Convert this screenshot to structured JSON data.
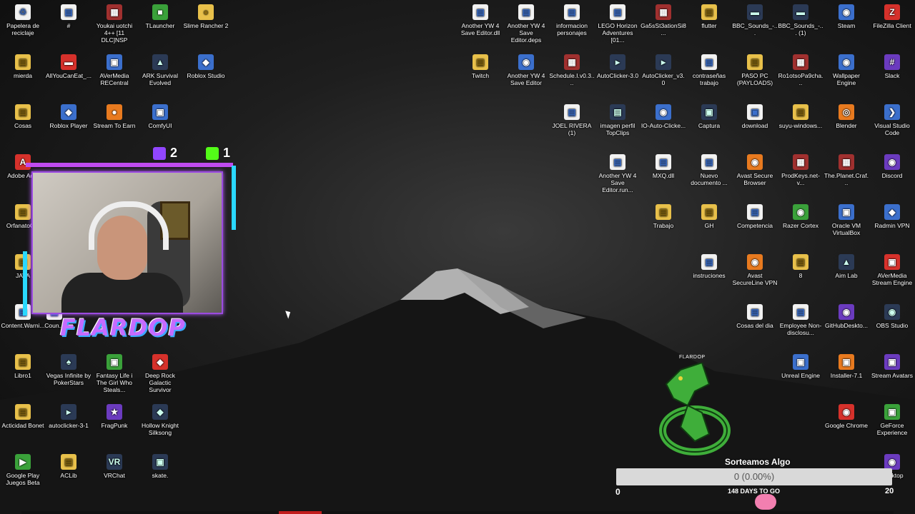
{
  "desktop_icons_left": [
    {
      "label": "Papelera de reciclaje",
      "glyph": "♲",
      "kind": "g-file",
      "icon": "recycle-bin-icon"
    },
    {
      "label": "#",
      "glyph": "▤",
      "kind": "g-file",
      "icon": "file-icon"
    },
    {
      "label": "Youkai uotchi 4++ [11 DLC]NSP",
      "glyph": "▦",
      "kind": "g-rar",
      "icon": "winrar-icon"
    },
    {
      "label": "TLauncher",
      "glyph": "■",
      "kind": "g-green",
      "icon": "tlauncher-icon"
    },
    {
      "label": "Slime Rancher 2",
      "glyph": "●",
      "kind": "g-folder",
      "icon": "slime-rancher-icon"
    },
    {
      "label": "mierda",
      "glyph": "▤",
      "kind": "g-folder",
      "icon": "folder-icon"
    },
    {
      "label": "AllYouCanEat_...",
      "glyph": "▬",
      "kind": "g-red",
      "icon": "file-icon"
    },
    {
      "label": "AVerMedia RECentral",
      "glyph": "▣",
      "kind": "g-app",
      "icon": "avermedia-icon"
    },
    {
      "label": "ARK Survival Evolved",
      "glyph": "▲",
      "kind": "g-dark",
      "icon": "ark-icon"
    },
    {
      "label": "Roblox Studio",
      "glyph": "◆",
      "kind": "g-app",
      "icon": "roblox-studio-icon"
    },
    {
      "label": "Cosas",
      "glyph": "▤",
      "kind": "g-folder",
      "icon": "folder-icon"
    },
    {
      "label": "Roblox Player",
      "glyph": "◆",
      "kind": "g-app",
      "icon": "roblox-icon"
    },
    {
      "label": "Stream To Earn",
      "glyph": "●",
      "kind": "g-orange",
      "icon": "stream-to-earn-icon"
    },
    {
      "label": "ComfyUI",
      "glyph": "▣",
      "kind": "g-app",
      "icon": "comfyui-icon"
    },
    {
      "label": "Adobe Ac...",
      "glyph": "A",
      "kind": "g-red",
      "icon": "adobe-acrobat-icon"
    },
    {
      "label": "OrfanatoC...",
      "glyph": "▤",
      "kind": "g-folder",
      "icon": "folder-icon"
    },
    {
      "label": "JAVA",
      "glyph": "▤",
      "kind": "g-folder",
      "icon": "folder-icon"
    },
    {
      "label": "Content.Warni...",
      "glyph": "▤",
      "kind": "g-file",
      "icon": "file-icon"
    },
    {
      "label": "Libro1",
      "glyph": "▤",
      "kind": "g-folder",
      "icon": "spreadsheet-icon"
    },
    {
      "label": "Vegas Infinite by PokerStars",
      "glyph": "♠",
      "kind": "g-dark",
      "icon": "vegas-infinite-icon"
    },
    {
      "label": "Fantasy Life i The Girl Who Steals...",
      "glyph": "▣",
      "kind": "g-green",
      "icon": "fantasy-life-icon"
    },
    {
      "label": "Deep Rock Galactic Survivor",
      "glyph": "◆",
      "kind": "g-red",
      "icon": "deep-rock-icon"
    },
    {
      "label": "Acticidad Bonet",
      "glyph": "▤",
      "kind": "g-folder",
      "icon": "folder-icon"
    },
    {
      "label": "autoclicker-3-1",
      "glyph": "▸",
      "kind": "g-dark",
      "icon": "autoclicker-icon"
    },
    {
      "label": "FragPunk",
      "glyph": "★",
      "kind": "g-purple",
      "icon": "fragpunk-icon"
    },
    {
      "label": "Hollow Knight Silksong",
      "glyph": "◆",
      "kind": "g-dark",
      "icon": "hollow-knight-icon"
    },
    {
      "label": "Google Play Juegos Beta",
      "glyph": "▶",
      "kind": "g-green",
      "icon": "google-play-icon"
    },
    {
      "label": "ACLib",
      "glyph": "▤",
      "kind": "g-folder",
      "icon": "file-icon"
    },
    {
      "label": "VRChat",
      "glyph": "VR",
      "kind": "g-dark",
      "icon": "vrchat-icon"
    },
    {
      "label": "skate.",
      "glyph": "▣",
      "kind": "g-dark",
      "icon": "skate-icon"
    },
    {
      "label": "Coun...",
      "glyph": "▤",
      "kind": "g-file",
      "icon": "file-icon"
    }
  ],
  "desktop_icons_right": [
    {
      "label": "Another YW 4 Save Editor.dll",
      "glyph": "▤",
      "kind": "g-file",
      "icon": "dll-icon"
    },
    {
      "label": "Another YW 4 Save Editor.deps",
      "glyph": "▤",
      "kind": "g-file",
      "icon": "file-icon"
    },
    {
      "label": "informacion personajes",
      "glyph": "▤",
      "kind": "g-file",
      "icon": "document-icon"
    },
    {
      "label": "LEGO Horizon Adventures [01...",
      "glyph": "▤",
      "kind": "g-file",
      "icon": "file-icon"
    },
    {
      "label": "Ga5sSt3ationSi8...",
      "glyph": "▦",
      "kind": "g-rar",
      "icon": "winrar-icon"
    },
    {
      "label": "flutter",
      "glyph": "▤",
      "kind": "g-folder",
      "icon": "folder-icon"
    },
    {
      "label": "BBC_Sounds_-...",
      "glyph": "▬",
      "kind": "g-dark",
      "icon": "media-icon"
    },
    {
      "label": "BBC_Sounds_-... (1)",
      "glyph": "▬",
      "kind": "g-dark",
      "icon": "media-icon"
    },
    {
      "label": "Steam",
      "glyph": "◉",
      "kind": "g-app",
      "icon": "steam-icon"
    },
    {
      "label": "FileZilla Client",
      "glyph": "Z",
      "kind": "g-red",
      "icon": "filezilla-icon"
    },
    {
      "label": "Twitch",
      "glyph": "▤",
      "kind": "g-folder",
      "icon": "folder-icon"
    },
    {
      "label": "Another YW 4 Save Editor",
      "glyph": "◉",
      "kind": "g-app",
      "icon": "app-icon"
    },
    {
      "label": "Schedule.I.v0.3....",
      "glyph": "▦",
      "kind": "g-rar",
      "icon": "winrar-icon"
    },
    {
      "label": "AutoClicker-3.0",
      "glyph": "▸",
      "kind": "g-dark",
      "icon": "autoclicker-icon"
    },
    {
      "label": "AutoClicker_v3.0",
      "glyph": "▸",
      "kind": "g-dark",
      "icon": "autoclicker-icon"
    },
    {
      "label": "contraseñas trabajo",
      "glyph": "▤",
      "kind": "g-file",
      "icon": "document-icon"
    },
    {
      "label": "PASO PC (PAYLOADS)",
      "glyph": "▤",
      "kind": "g-folder",
      "icon": "folder-icon"
    },
    {
      "label": "Ro1otsoPa9cha...",
      "glyph": "▦",
      "kind": "g-rar",
      "icon": "winrar-icon"
    },
    {
      "label": "Wallpaper Engine",
      "glyph": "◉",
      "kind": "g-app",
      "icon": "wallpaper-engine-icon"
    },
    {
      "label": "Slack",
      "glyph": "#",
      "kind": "g-purple",
      "icon": "slack-icon"
    },
    {
      "label": "JOEL RIVERA (1)",
      "glyph": "▤",
      "kind": "g-file",
      "icon": "pdf-icon"
    },
    {
      "label": "imagen perfil TopClips",
      "glyph": "▤",
      "kind": "g-dark",
      "icon": "image-icon"
    },
    {
      "label": "IO-Auto-Clicke...",
      "glyph": "◉",
      "kind": "g-app",
      "icon": "autoclicker-icon"
    },
    {
      "label": "Captura",
      "glyph": "▣",
      "kind": "g-dark",
      "icon": "image-icon"
    },
    {
      "label": "download",
      "glyph": "▣",
      "kind": "g-file",
      "icon": "image-icon"
    },
    {
      "label": "suyu-windows...",
      "glyph": "▤",
      "kind": "g-folder",
      "icon": "folder-icon"
    },
    {
      "label": "Blender",
      "glyph": "◎",
      "kind": "g-orange",
      "icon": "blender-icon"
    },
    {
      "label": "Visual Studio Code",
      "glyph": "❯",
      "kind": "g-app",
      "icon": "vscode-icon"
    },
    {
      "label": "Another YW 4 Save Editor.run...",
      "glyph": "▤",
      "kind": "g-file",
      "icon": "file-icon"
    },
    {
      "label": "MXQ.dll",
      "glyph": "▤",
      "kind": "g-file",
      "icon": "dll-icon"
    },
    {
      "label": "Nuevo documento ...",
      "glyph": "▤",
      "kind": "g-file",
      "icon": "document-icon"
    },
    {
      "label": "Avast Secure Browser",
      "glyph": "◉",
      "kind": "g-orange",
      "icon": "avast-browser-icon"
    },
    {
      "label": "ProdKeys.net-v...",
      "glyph": "▦",
      "kind": "g-rar",
      "icon": "winrar-icon"
    },
    {
      "label": "The.Planet.Craf...",
      "glyph": "▦",
      "kind": "g-rar",
      "icon": "winrar-icon"
    },
    {
      "label": "Discord",
      "glyph": "◉",
      "kind": "g-purple",
      "icon": "discord-icon"
    },
    {
      "label": "Trabajo",
      "glyph": "▤",
      "kind": "g-folder",
      "icon": "folder-icon"
    },
    {
      "label": "GH",
      "glyph": "▤",
      "kind": "g-folder",
      "icon": "folder-icon"
    },
    {
      "label": "Competencia",
      "glyph": "▤",
      "kind": "g-file",
      "icon": "document-icon"
    },
    {
      "label": "Razer Cortex",
      "glyph": "◉",
      "kind": "g-green",
      "icon": "razer-cortex-icon"
    },
    {
      "label": "Oracle VM VirtualBox",
      "glyph": "▣",
      "kind": "g-app",
      "icon": "virtualbox-icon"
    },
    {
      "label": "Radmin VPN",
      "glyph": "◆",
      "kind": "g-app",
      "icon": "radmin-vpn-icon"
    },
    {
      "label": "instruciones",
      "glyph": "▤",
      "kind": "g-file",
      "icon": "document-icon"
    },
    {
      "label": "Avast SecureLine VPN",
      "glyph": "◉",
      "kind": "g-orange",
      "icon": "avast-vpn-icon"
    },
    {
      "label": "8",
      "glyph": "▤",
      "kind": "g-folder",
      "icon": "folder-icon"
    },
    {
      "label": "Aim Lab",
      "glyph": "▲",
      "kind": "g-dark",
      "icon": "aim-lab-icon"
    },
    {
      "label": "AVerMedia Stream Engine",
      "glyph": "▣",
      "kind": "g-red",
      "icon": "avermedia-icon"
    },
    {
      "label": "Cosas del dia",
      "glyph": "▤",
      "kind": "g-file",
      "icon": "document-icon"
    },
    {
      "label": "Employee Non-disclosu...",
      "glyph": "▤",
      "kind": "g-file",
      "icon": "pdf-icon"
    },
    {
      "label": "GitHubDeskto...",
      "glyph": "◉",
      "kind": "g-purple",
      "icon": "github-desktop-icon"
    },
    {
      "label": "OBS Studio",
      "glyph": "◉",
      "kind": "g-dark",
      "icon": "obs-icon"
    },
    {
      "label": "Unreal Engine",
      "glyph": "▣",
      "kind": "g-app",
      "icon": "unreal-engine-icon"
    },
    {
      "label": "Installer-7.1",
      "glyph": "▣",
      "kind": "g-orange",
      "icon": "installer-icon"
    },
    {
      "label": "Stream Avatars",
      "glyph": "▣",
      "kind": "g-purple",
      "icon": "stream-avatars-icon"
    },
    {
      "label": "Google Chrome",
      "glyph": "◉",
      "kind": "g-red",
      "icon": "chrome-icon"
    },
    {
      "label": "GeForce Experience",
      "glyph": "▣",
      "kind": "g-green",
      "icon": "geforce-icon"
    },
    {
      "label": "Desktop",
      "glyph": "◉",
      "kind": "g-purple",
      "icon": "app-icon"
    }
  ],
  "overlay": {
    "streamer_name": "FLARDOP",
    "twitch_count": "2",
    "kick_count": "1",
    "pokemon_tag": "FLARDOP",
    "goal_title": "Sorteamos Algo",
    "goal_progress_text": "0 (0.00%)",
    "goal_progress_fraction": 0,
    "goal_min": "0",
    "goal_max": "20",
    "goal_days": "148 DAYS TO GO"
  }
}
